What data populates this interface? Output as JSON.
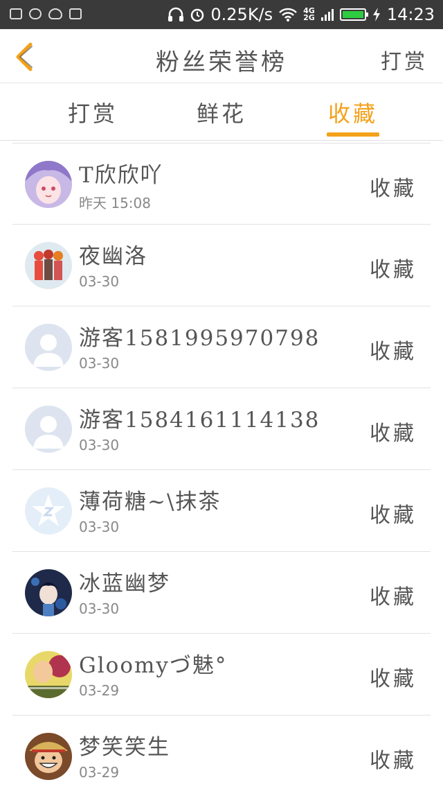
{
  "status_bar": {
    "network_speed": "0.25K/s",
    "network_type_top": "4G",
    "network_type_bottom": "2G",
    "time": "14:23"
  },
  "header": {
    "title": "粉丝荣誉榜",
    "right_action": "打赏"
  },
  "tabs": [
    {
      "label": "打赏",
      "active": false
    },
    {
      "label": "鲜花",
      "active": false
    },
    {
      "label": "收藏",
      "active": true
    }
  ],
  "colors": {
    "accent": "#f4a11b",
    "status_bar_bg": "#3a3a3a",
    "text": "#555555"
  },
  "fans": [
    {
      "name": "T欣欣吖",
      "time": "昨天 15:08",
      "action": "收藏",
      "avatar": "anime-girl-avatar"
    },
    {
      "name": "夜幽洛",
      "time": "03-30",
      "action": "收藏",
      "avatar": "group-characters-avatar"
    },
    {
      "name": "游客15819959707​98",
      "time": "03-30",
      "action": "收藏",
      "avatar": "default-user-avatar"
    },
    {
      "name": "游客15841611141​38",
      "time": "03-30",
      "action": "收藏",
      "avatar": "default-user-avatar"
    },
    {
      "name": "薄荷糖~\\抹茶",
      "time": "03-30",
      "action": "收藏",
      "avatar": "qq-star-avatar"
    },
    {
      "name": "冰蓝幽梦",
      "time": "03-30",
      "action": "收藏",
      "avatar": "dark-anime-avatar"
    },
    {
      "name": "Gloomyづ魅°",
      "time": "03-29",
      "action": "收藏",
      "avatar": "yellow-photo-avatar"
    },
    {
      "name": "梦笑笑生",
      "time": "03-29",
      "action": "收藏",
      "avatar": "luffy-avatar"
    }
  ]
}
